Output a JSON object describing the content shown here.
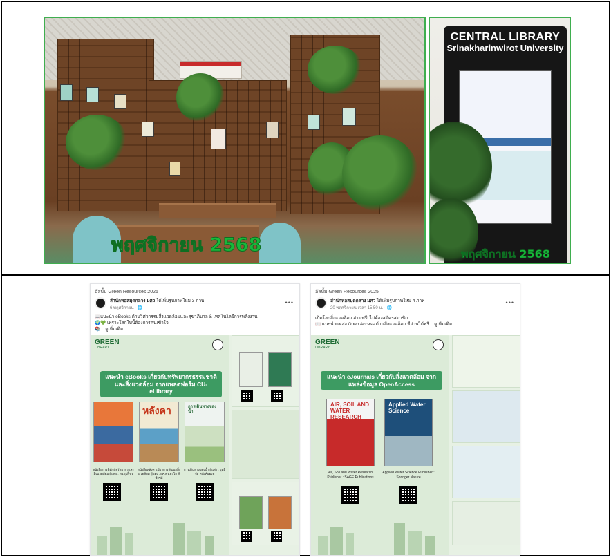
{
  "photos": {
    "left_caption": "พฤศจิกายน 2568",
    "right_caption": "พฤศจิกายน 2568",
    "kiosk_title_line1": "CENTRAL LIBRARY",
    "kiosk_title_line2": "Srinakharinwirot University"
  },
  "posts": [
    {
      "group": "อัลบั้ม Green Resources 2025",
      "author": "สำนักหอสมุดกลาง มศว",
      "author_suffix": "ได้เพิ่มรูปภาพใหม่ 3 ภาพ",
      "meta": "6 พฤศจิกายน · 🌐",
      "lines": [
        "📖แนะนำ eBooks ด้านวิศวกรรมสิ่งแวดล้อมและสุขาภิบาล & เทคโนโลยีการพลังงาน",
        "🌍💚 เพราะโลกใบนี้ต้องการคนเข้าใจ",
        "📚... ดูเพิ่มเติม"
      ],
      "banner": "แนะนำ eBooks เกี่ยวกับทรัพยากรธรรมชาติ และสิ่งแวดล้อม จากแพลตฟอร์ม CU-eLibrary",
      "books": [
        {
          "caption": "หนังสือการพิทักษ์ทรัพยากรและสิ่งแวดล้อม ผู้แต่ง : ดร.ภูเพ็ชร"
        },
        {
          "cover_title": "หลังคา",
          "caption": "หนังสือหลังคาเขียวการพัฒนาสิ่งแวดล้อม ผู้แต่ง : ผศ.ดร.อรไท สีชิงชลี"
        },
        {
          "cover_title": "การเดินทางของน้ำ",
          "caption": "การเดินทางของน้ำ ผู้แต่ง : ยุทธิชัย คนังค์ยองพ"
        }
      ]
    },
    {
      "group": "อัลบั้ม Green Resources 2025",
      "author": "สำนักหอสมุดกลาง มศว",
      "author_suffix": "ได้เพิ่มรูปภาพใหม่ 4 ภาพ",
      "meta": "20 พฤศจิกายน เวลา 15:50 น. · 🌐",
      "lines": [
        "เปิดโลกสิ่งแวดล้อม อ่านฟรี! ไม่ต้องสมัครสมาชิก",
        "📖 แนะนำแหล่ง Open Access ด้านสิ่งแวดล้อม ที่อ่านได้ฟรี... ดูเพิ่มเติม"
      ],
      "banner": "แนะนำ eJournals เกี่ยวกับสิ่งแวดล้อม จากแหล่งข้อมูล OpenAccess",
      "journals": [
        {
          "title": "AIR, SOIL AND WATER RESEARCH",
          "caption": "Air, Soil and Water Research Publisher : SAGE Publications"
        },
        {
          "title": "Applied Water Science",
          "caption": "Applied Water Science Publisher : Springer Nature"
        }
      ]
    }
  ],
  "colors": {
    "caption_green": "#18b83a",
    "panel_green": "#3d9b62"
  }
}
